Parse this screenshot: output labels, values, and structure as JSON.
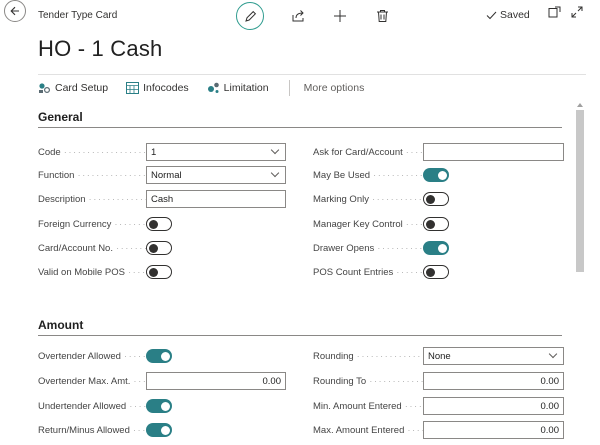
{
  "header": {
    "breadcrumb": "Tender Type Card",
    "title": "HO - 1 Cash",
    "saved_label": "Saved"
  },
  "actions": {
    "card_setup": "Card Setup",
    "infocodes": "Infocodes",
    "limitation": "Limitation",
    "more_options": "More options"
  },
  "general": {
    "title": "General",
    "left": [
      {
        "label": "Code",
        "type": "select",
        "value": "1"
      },
      {
        "label": "Function",
        "type": "select",
        "value": "Normal"
      },
      {
        "label": "Description",
        "type": "text",
        "value": "Cash"
      },
      {
        "label": "Foreign Currency",
        "type": "toggle",
        "value": "off"
      },
      {
        "label": "Card/Account No.",
        "type": "toggle",
        "value": "off"
      },
      {
        "label": "Valid on Mobile POS",
        "type": "toggle",
        "value": "off"
      }
    ],
    "right": [
      {
        "label": "Ask for Card/Account",
        "type": "text",
        "value": ""
      },
      {
        "label": "May Be Used",
        "type": "toggle",
        "value": "on"
      },
      {
        "label": "Marking Only",
        "type": "toggle",
        "value": "off"
      },
      {
        "label": "Manager Key Control",
        "type": "toggle",
        "value": "off"
      },
      {
        "label": "Drawer Opens",
        "type": "toggle",
        "value": "on"
      },
      {
        "label": "POS Count Entries",
        "type": "toggle",
        "value": "off"
      }
    ]
  },
  "amount": {
    "title": "Amount",
    "left": [
      {
        "label": "Overtender Allowed",
        "type": "toggle",
        "value": "on"
      },
      {
        "label": "Overtender Max. Amt.",
        "type": "number",
        "value": "0.00"
      },
      {
        "label": "Undertender Allowed",
        "type": "toggle",
        "value": "on"
      },
      {
        "label": "Return/Minus Allowed",
        "type": "toggle",
        "value": "on"
      }
    ],
    "right": [
      {
        "label": "Rounding",
        "type": "select",
        "value": "None"
      },
      {
        "label": "Rounding To",
        "type": "number",
        "value": "0.00"
      },
      {
        "label": "Min. Amount Entered",
        "type": "number",
        "value": "0.00"
      },
      {
        "label": "Max. Amount Entered",
        "type": "number",
        "value": "0.00"
      }
    ]
  },
  "colors": {
    "accent": "#2a7f86",
    "edit_ring": "#2f9c8f"
  }
}
